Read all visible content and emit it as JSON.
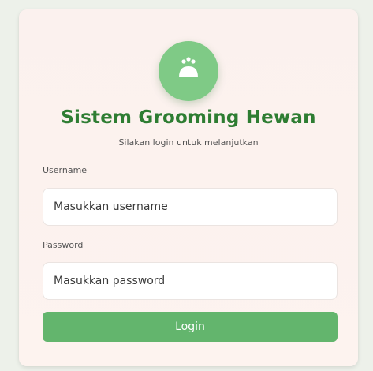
{
  "login": {
    "title": "Sistem Grooming Hewan",
    "subtitle": "Silakan login untuk melanjutkan",
    "username_label": "Username",
    "username_placeholder": "Masukkan username",
    "password_label": "Password",
    "password_placeholder": "Masukkan password",
    "login_button": "Login"
  },
  "icons": {
    "logo": "paw-face-icon"
  },
  "colors": {
    "accent": "#2e7d32",
    "button": "#63b56d",
    "logo_bg": "#7fca86",
    "card_bg": "#fbf1ee",
    "page_bg": "#edf1ea"
  }
}
